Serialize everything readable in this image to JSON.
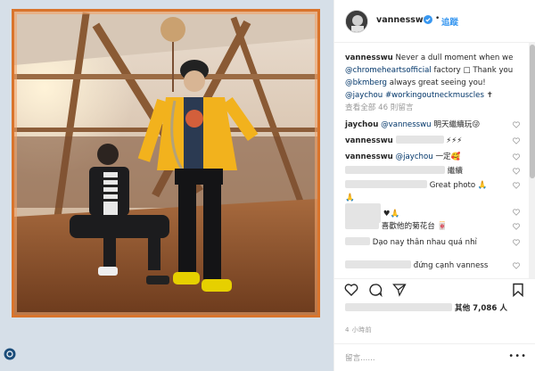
{
  "header": {
    "username": "vannesswu",
    "dot": "•",
    "follow_label": "追蹤"
  },
  "caption": {
    "username": "vannesswu",
    "text_1": "Never a dull moment when we ",
    "mention_1": "@chromeheartsofficial",
    "text_2": " factory ",
    "text_3": " Thank you ",
    "mention_2": "@bkmberg",
    "text_4": " always great seeing you! ",
    "mention_3": "@jaychou",
    "text_5": " ",
    "mention_4": "#workingoutneckmuscles",
    "text_6": " ✝"
  },
  "view_all": "查看全部 46 則留言",
  "comments": [
    {
      "user": "jaychou",
      "mention": "@vannesswu",
      "text": " 明天繼續玩😜"
    },
    {
      "user": "vannesswu",
      "mention": "",
      "text": " ⚡⚡⚡"
    },
    {
      "user": "vannesswu",
      "mention": "@jaychou",
      "text": " 一定🥰"
    },
    {
      "user": "",
      "mention": "",
      "text": "繼續"
    },
    {
      "user": "",
      "mention": "",
      "text": " Great photo 🙏"
    },
    {
      "user": "",
      "mention": "",
      "text": "🙏"
    },
    {
      "user": "",
      "mention": "",
      "text": "♥🙏"
    },
    {
      "user": "",
      "mention": "",
      "text": "喜歡他的菊花台 🀄"
    },
    {
      "user": "",
      "mention": "",
      "text": " Dạo nay thân nhau quá nhỉ"
    },
    {
      "user": "",
      "mention": "",
      "text": "đứng cạnh vanness"
    }
  ],
  "likes": {
    "text": "其他 7,086 人"
  },
  "time": "4 小時前",
  "comment_placeholder": "留言......",
  "more": "•••",
  "colors": {
    "accent": "#3897f0",
    "frame": "#d9742c",
    "jacket": "#f2b21d",
    "sneakers": "#e6d000"
  }
}
